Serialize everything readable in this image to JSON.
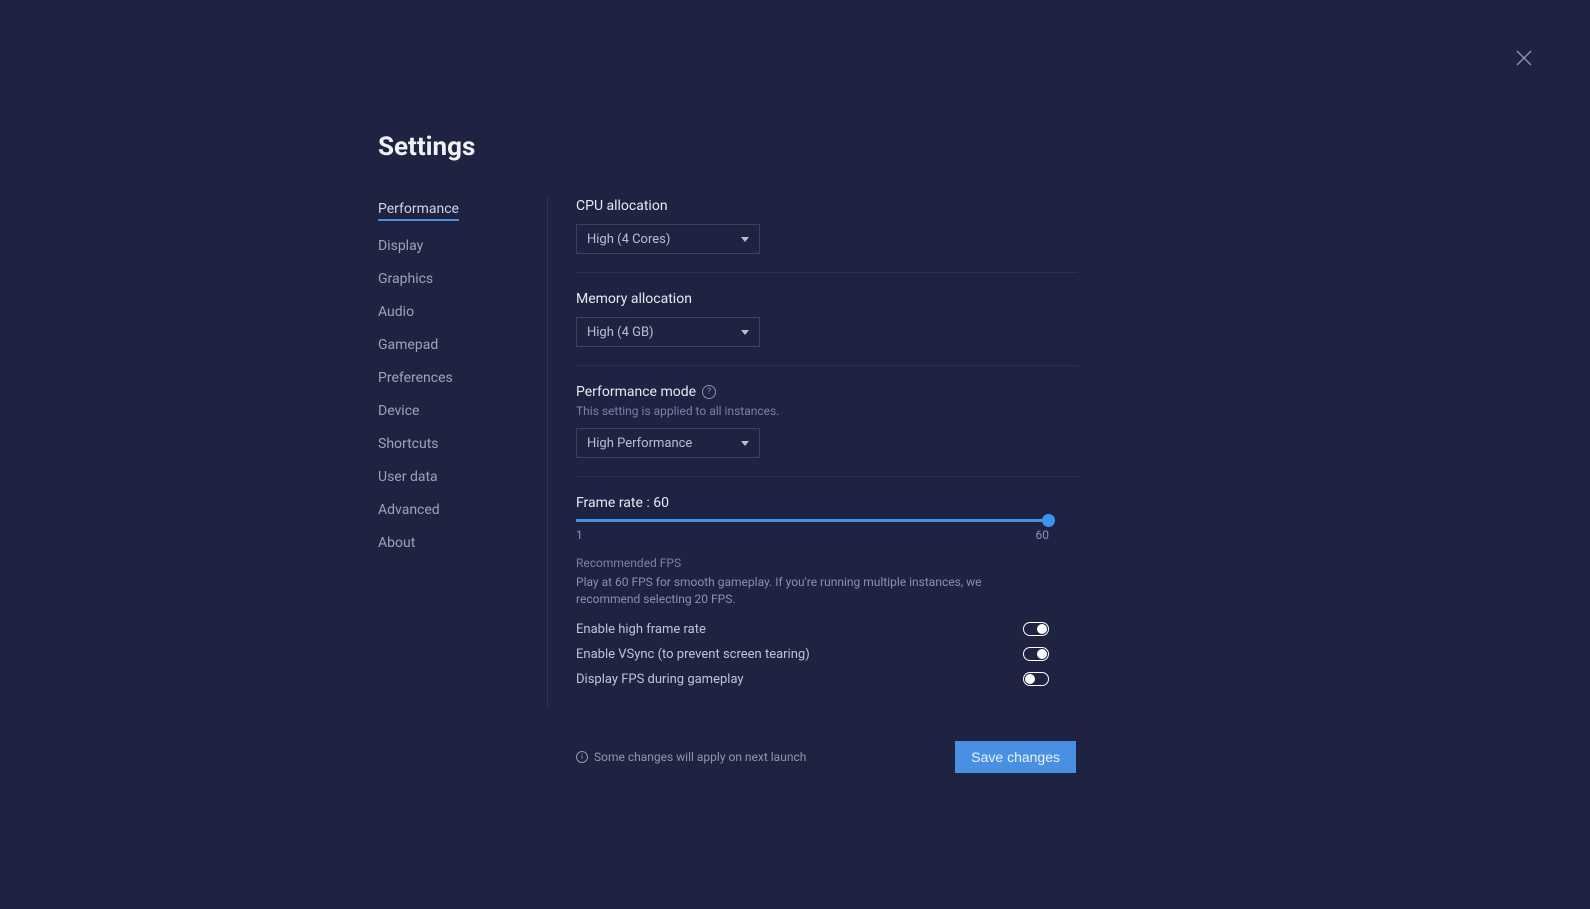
{
  "title": "Settings",
  "sidebar": {
    "items": [
      {
        "label": "Performance",
        "active": true
      },
      {
        "label": "Display"
      },
      {
        "label": "Graphics"
      },
      {
        "label": "Audio"
      },
      {
        "label": "Gamepad"
      },
      {
        "label": "Preferences"
      },
      {
        "label": "Device"
      },
      {
        "label": "Shortcuts"
      },
      {
        "label": "User data"
      },
      {
        "label": "Advanced"
      },
      {
        "label": "About"
      }
    ]
  },
  "cpu": {
    "label": "CPU allocation",
    "value": "High (4 Cores)"
  },
  "memory": {
    "label": "Memory allocation",
    "value": "High (4 GB)"
  },
  "perfmode": {
    "label": "Performance mode",
    "sublabel": "This setting is applied to all instances.",
    "value": "High Performance"
  },
  "framerate": {
    "label_prefix": "Frame rate : ",
    "value": "60",
    "min": "1",
    "max": "60",
    "rec_title": "Recommended FPS",
    "rec_text": "Play at 60 FPS for smooth gameplay. If you're running multiple instances, we recommend selecting 20 FPS."
  },
  "toggles": {
    "high_frame": {
      "label": "Enable high frame rate",
      "on": true
    },
    "vsync": {
      "label": "Enable VSync (to prevent screen tearing)",
      "on": true
    },
    "display_fps": {
      "label": "Display FPS during gameplay",
      "on": false
    }
  },
  "footer": {
    "note": "Some changes will apply on next launch",
    "save": "Save changes"
  }
}
